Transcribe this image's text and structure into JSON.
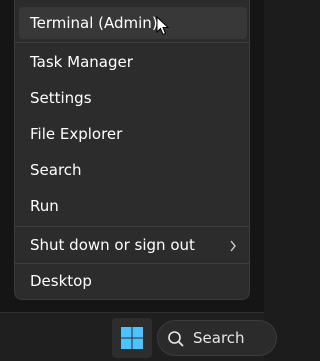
{
  "menu": {
    "items": [
      {
        "label": "Terminal (Admin)"
      },
      {
        "label": "Task Manager"
      },
      {
        "label": "Settings"
      },
      {
        "label": "File Explorer"
      },
      {
        "label": "Search"
      },
      {
        "label": "Run"
      },
      {
        "label": "Shut down or sign out",
        "icon": "chevron-right-icon"
      },
      {
        "label": "Desktop"
      }
    ]
  },
  "taskbar": {
    "start_icon": "windows-logo-icon",
    "search_icon": "search-icon",
    "search_label": "Search"
  },
  "colors": {
    "menu_bg": "#2c2c2c",
    "hover_bg": "#383838",
    "taskbar_bg": "#1f1f1f",
    "accent": "#4cc2ff"
  }
}
